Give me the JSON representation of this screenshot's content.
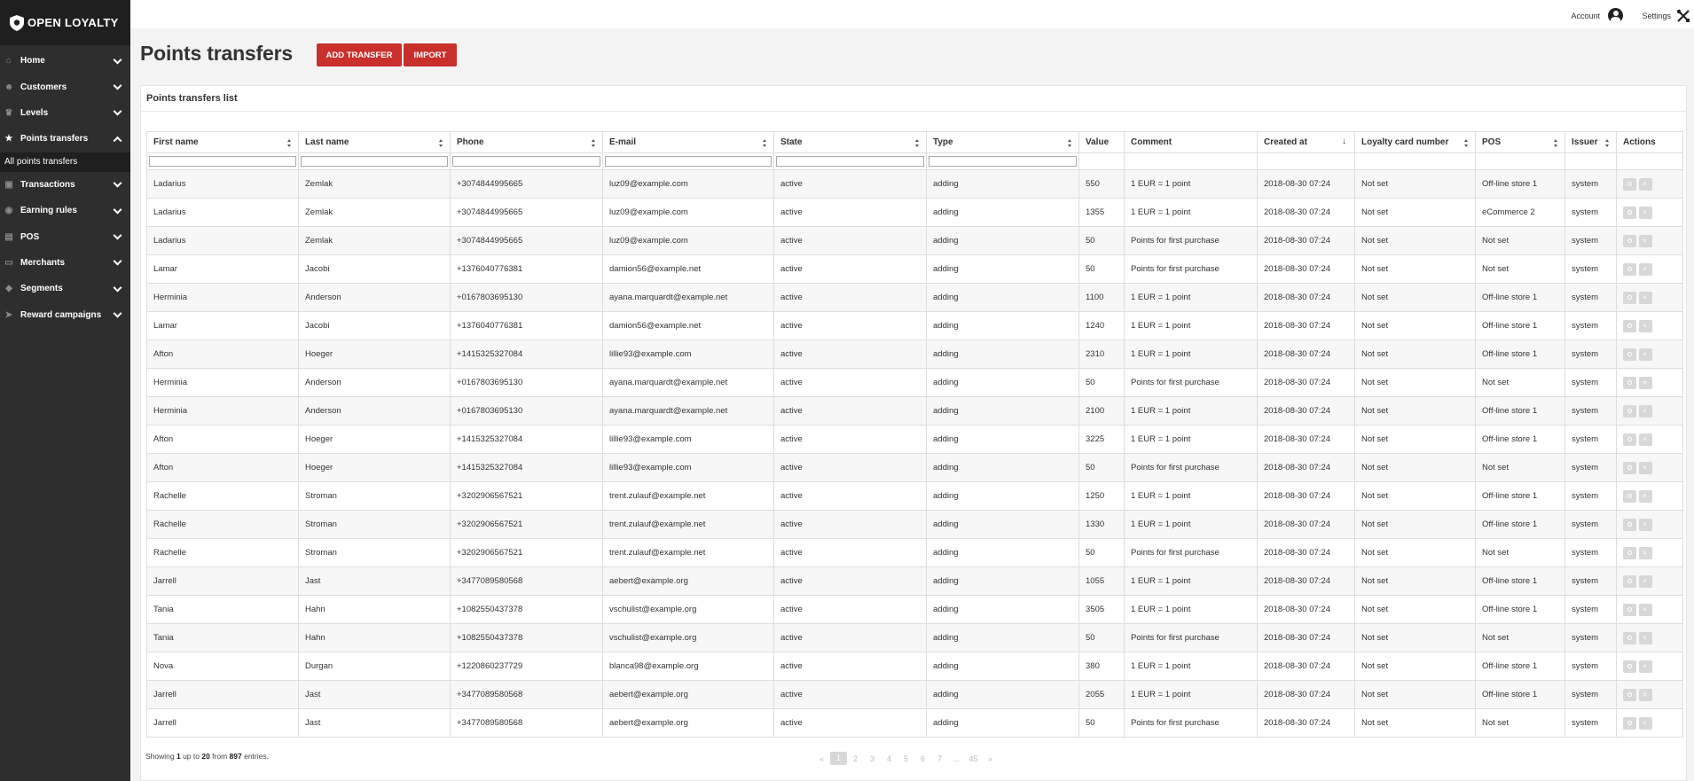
{
  "brand": {
    "name": "OPEN LOYALTY"
  },
  "topbar": {
    "account_label": "Account",
    "settings_label": "Settings"
  },
  "sidebar": {
    "items": [
      {
        "label": "Home",
        "icon": "home-icon",
        "open": false
      },
      {
        "label": "Customers",
        "icon": "users-icon",
        "open": false
      },
      {
        "label": "Levels",
        "icon": "trophy-icon",
        "open": false
      },
      {
        "label": "Points transfers",
        "icon": "star-icon",
        "open": true
      },
      {
        "label": "Transactions",
        "icon": "store-icon",
        "open": false
      },
      {
        "label": "Earning rules",
        "icon": "hand-coins-icon",
        "open": false
      },
      {
        "label": "POS",
        "icon": "pos-icon",
        "open": false
      },
      {
        "label": "Merchants",
        "icon": "id-card-icon",
        "open": false
      },
      {
        "label": "Segments",
        "icon": "tag-icon",
        "open": false
      },
      {
        "label": "Reward campaigns",
        "icon": "send-icon",
        "open": false
      }
    ],
    "sub_item": "All points transfers"
  },
  "page": {
    "title": "Points transfers",
    "add_button": "ADD TRANSFER",
    "import_button": "IMPORT",
    "panel_title": "Points transfers list"
  },
  "table": {
    "columns": [
      "First name",
      "Last name",
      "Phone",
      "E-mail",
      "State",
      "Type",
      "Value",
      "Comment",
      "Created at",
      "Loyalty card number",
      "POS",
      "Issuer",
      "Actions"
    ],
    "rows": [
      [
        "Ladarius",
        "Zemlak",
        "+3074844995665",
        "luz09@example.com",
        "active",
        "adding",
        "550",
        "1 EUR = 1 point",
        "2018-08-30 07:24",
        "Not set",
        "Off-line store 1",
        "system"
      ],
      [
        "Ladarius",
        "Zemlak",
        "+3074844995665",
        "luz09@example.com",
        "active",
        "adding",
        "1355",
        "1 EUR = 1 point",
        "2018-08-30 07:24",
        "Not set",
        "eCommerce 2",
        "system"
      ],
      [
        "Ladarius",
        "Zemlak",
        "+3074844995665",
        "luz09@example.com",
        "active",
        "adding",
        "50",
        "Points for first purchase",
        "2018-08-30 07:24",
        "Not set",
        "Not set",
        "system"
      ],
      [
        "Lamar",
        "Jacobi",
        "+1376040776381",
        "damion56@example.net",
        "active",
        "adding",
        "50",
        "Points for first purchase",
        "2018-08-30 07:24",
        "Not set",
        "Not set",
        "system"
      ],
      [
        "Herminia",
        "Anderson",
        "+0167803695130",
        "ayana.marquardt@example.net",
        "active",
        "adding",
        "1100",
        "1 EUR = 1 point",
        "2018-08-30 07:24",
        "Not set",
        "Off-line store 1",
        "system"
      ],
      [
        "Lamar",
        "Jacobi",
        "+1376040776381",
        "damion56@example.net",
        "active",
        "adding",
        "1240",
        "1 EUR = 1 point",
        "2018-08-30 07:24",
        "Not set",
        "Off-line store 1",
        "system"
      ],
      [
        "Afton",
        "Hoeger",
        "+1415325327084",
        "lillie93@example.com",
        "active",
        "adding",
        "2310",
        "1 EUR = 1 point",
        "2018-08-30 07:24",
        "Not set",
        "Off-line store 1",
        "system"
      ],
      [
        "Herminia",
        "Anderson",
        "+0167803695130",
        "ayana.marquardt@example.net",
        "active",
        "adding",
        "50",
        "Points for first purchase",
        "2018-08-30 07:24",
        "Not set",
        "Not set",
        "system"
      ],
      [
        "Herminia",
        "Anderson",
        "+0167803695130",
        "ayana.marquardt@example.net",
        "active",
        "adding",
        "2100",
        "1 EUR = 1 point",
        "2018-08-30 07:24",
        "Not set",
        "Off-line store 1",
        "system"
      ],
      [
        "Afton",
        "Hoeger",
        "+1415325327084",
        "lillie93@example.com",
        "active",
        "adding",
        "3225",
        "1 EUR = 1 point",
        "2018-08-30 07:24",
        "Not set",
        "Off-line store 1",
        "system"
      ],
      [
        "Afton",
        "Hoeger",
        "+1415325327084",
        "lillie93@example.com",
        "active",
        "adding",
        "50",
        "Points for first purchase",
        "2018-08-30 07:24",
        "Not set",
        "Not set",
        "system"
      ],
      [
        "Rachelle",
        "Stroman",
        "+3202906567521",
        "trent.zulauf@example.net",
        "active",
        "adding",
        "1250",
        "1 EUR = 1 point",
        "2018-08-30 07:24",
        "Not set",
        "Off-line store 1",
        "system"
      ],
      [
        "Rachelle",
        "Stroman",
        "+3202906567521",
        "trent.zulauf@example.net",
        "active",
        "adding",
        "1330",
        "1 EUR = 1 point",
        "2018-08-30 07:24",
        "Not set",
        "Off-line store 1",
        "system"
      ],
      [
        "Rachelle",
        "Stroman",
        "+3202906567521",
        "trent.zulauf@example.net",
        "active",
        "adding",
        "50",
        "Points for first purchase",
        "2018-08-30 07:24",
        "Not set",
        "Not set",
        "system"
      ],
      [
        "Jarrell",
        "Jast",
        "+3477089580568",
        "aebert@example.org",
        "active",
        "adding",
        "1055",
        "1 EUR = 1 point",
        "2018-08-30 07:24",
        "Not set",
        "Off-line store 1",
        "system"
      ],
      [
        "Tania",
        "Hahn",
        "+1082550437378",
        "vschulist@example.org",
        "active",
        "adding",
        "3505",
        "1 EUR = 1 point",
        "2018-08-30 07:24",
        "Not set",
        "Off-line store 1",
        "system"
      ],
      [
        "Tania",
        "Hahn",
        "+1082550437378",
        "vschulist@example.org",
        "active",
        "adding",
        "50",
        "Points for first purchase",
        "2018-08-30 07:24",
        "Not set",
        "Not set",
        "system"
      ],
      [
        "Nova",
        "Durgan",
        "+1220860237729",
        "blanca98@example.org",
        "active",
        "adding",
        "380",
        "1 EUR = 1 point",
        "2018-08-30 07:24",
        "Not set",
        "Off-line store 1",
        "system"
      ],
      [
        "Jarrell",
        "Jast",
        "+3477089580568",
        "aebert@example.org",
        "active",
        "adding",
        "2055",
        "1 EUR = 1 point",
        "2018-08-30 07:24",
        "Not set",
        "Off-line store 1",
        "system"
      ],
      [
        "Jarrell",
        "Jast",
        "+3477089580568",
        "aebert@example.org",
        "active",
        "adding",
        "50",
        "Points for first purchase",
        "2018-08-30 07:24",
        "Not set",
        "Not set",
        "system"
      ]
    ]
  },
  "footer": {
    "showing_prefix": "Showing ",
    "showing_from": "1",
    "showing_mid": " up to ",
    "showing_to": "20",
    "showing_from_word": " from ",
    "showing_total": "897",
    "showing_suffix": " entries."
  },
  "pagination": [
    "«",
    "1",
    "2",
    "3",
    "4",
    "5",
    "6",
    "7",
    "...",
    "45",
    "»"
  ],
  "pagination_active": "1",
  "colors": {
    "accent": "#c9302c",
    "sidebar": "#2e2e2e",
    "sidebar_dark": "#1f1f1f"
  }
}
